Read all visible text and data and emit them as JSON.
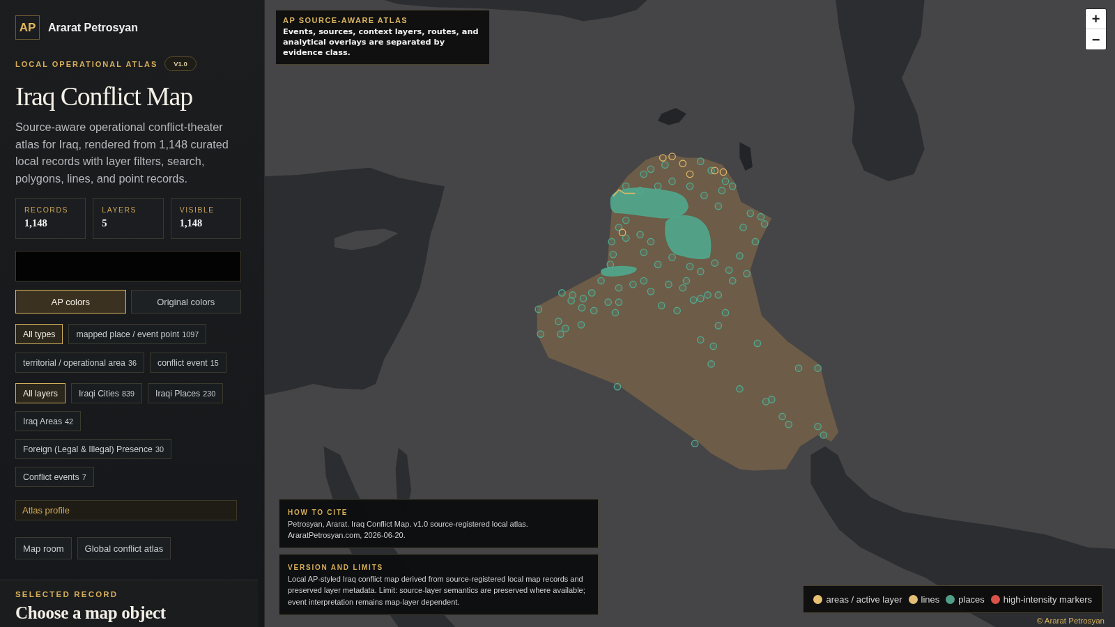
{
  "brand": {
    "logo": "AP",
    "name": "Ararat Petrosyan"
  },
  "intro": {
    "eyebrow": "LOCAL OPERATIONAL ATLAS",
    "badge": "V1.0",
    "title": "Iraq Conflict Map",
    "description": "Source-aware operational conflict-theater atlas for Iraq, rendered from 1,148 curated local records with layer filters, search, polygons, lines, and point records."
  },
  "stats": [
    {
      "label": "RECORDS",
      "value": "1,148"
    },
    {
      "label": "LAYERS",
      "value": "5"
    },
    {
      "label": "VISIBLE",
      "value": "1,148"
    }
  ],
  "color_modes": [
    {
      "label": "AP colors",
      "selected": true
    },
    {
      "label": "Original colors",
      "selected": false
    }
  ],
  "type_filters": [
    {
      "label": "All types",
      "selected": true
    },
    {
      "label": "mapped place / event point",
      "count": "1097",
      "selected": false
    },
    {
      "label": "territorial / operational area",
      "count": "36",
      "selected": false
    },
    {
      "label": "conflict event",
      "count": "15",
      "selected": false
    }
  ],
  "layer_filters": [
    {
      "label": "All layers",
      "selected": true
    },
    {
      "label": "Iraqi Cities",
      "count": "839",
      "selected": false
    },
    {
      "label": "Iraqi Places",
      "count": "230",
      "selected": false
    },
    {
      "label": "Iraq Areas",
      "count": "42",
      "selected": false
    },
    {
      "label": "Foreign (Legal & Illegal) Presence",
      "count": "30",
      "selected": false
    },
    {
      "label": "Conflict events",
      "count": "7",
      "selected": false
    }
  ],
  "atlas_profile": "Atlas profile",
  "links": [
    "Map room",
    "Global conflict atlas"
  ],
  "selected_record": {
    "eyebrow": "SELECTED RECORD",
    "title": "Choose a map object"
  },
  "map": {
    "info": {
      "title": "AP SOURCE-AWARE ATLAS",
      "body": "Events, sources, context layers, routes, and analytical overlays are separated by evidence class."
    },
    "zoom_in": "+",
    "zoom_out": "−",
    "notes": [
      {
        "title": "HOW TO CITE",
        "body": "Petrosyan, Ararat. Iraq Conflict Map. v1.0 source-registered local atlas. AraratPetrosyan.com, 2026-06-20."
      },
      {
        "title": "VERSION AND LIMITS",
        "body": "Local AP-styled Iraq conflict map derived from source-registered local map records and preserved layer metadata. Limit: source-layer semantics are preserved where available; event interpretation remains map-layer dependent."
      }
    ],
    "legend": [
      {
        "label": "areas / active layer",
        "color": "#e6c173"
      },
      {
        "label": "lines",
        "color": "#e3bf76"
      },
      {
        "label": "places",
        "color": "#4f9f88"
      },
      {
        "label": "high-intensity markers",
        "color": "#d9534a"
      }
    ],
    "attribution": "© Ararat Petrosyan"
  }
}
